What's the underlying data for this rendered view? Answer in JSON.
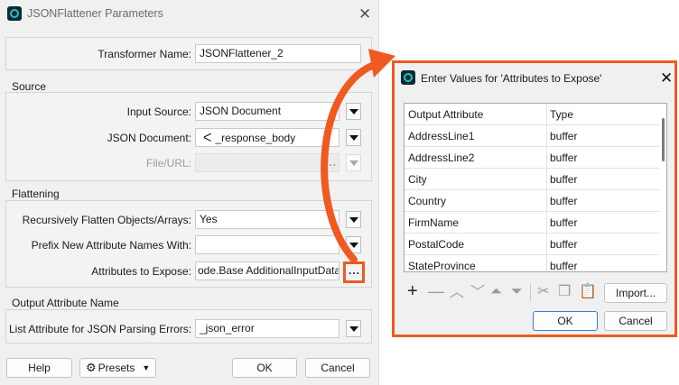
{
  "main": {
    "title": "JSONFlattener Parameters",
    "transformer_name_label": "Transformer Name:",
    "transformer_name_value": "JSONFlattener_2",
    "source": {
      "heading": "Source",
      "input_source_label": "Input Source:",
      "input_source_value": "JSON Document",
      "json_document_label": "JSON Document:",
      "json_document_value": "_response_body",
      "file_url_label": "File/URL:",
      "file_url_value": "",
      "browse": "..."
    },
    "flattening": {
      "heading": "Flattening",
      "recursive_label": "Recursively Flatten Objects/Arrays:",
      "recursive_value": "Yes",
      "prefix_label": "Prefix New Attribute Names With:",
      "prefix_value": "",
      "expose_label": "Attributes to Expose:",
      "expose_value": "ode.Base AdditionalInputData",
      "expose_button": "..."
    },
    "output": {
      "heading": "Output Attribute Name",
      "list_attr_label": "List Attribute for JSON Parsing Errors:",
      "list_attr_value": "_json_error"
    },
    "buttons": {
      "help": "Help",
      "presets": "Presets",
      "ok": "OK",
      "cancel": "Cancel"
    }
  },
  "dialog": {
    "title": "Enter Values for 'Attributes to Expose'",
    "columns": [
      "Output Attribute",
      "Type"
    ],
    "rows": [
      {
        "name": "AddressLine1",
        "type": "buffer"
      },
      {
        "name": "AddressLine2",
        "type": "buffer"
      },
      {
        "name": "City",
        "type": "buffer"
      },
      {
        "name": "Country",
        "type": "buffer"
      },
      {
        "name": "FirmName",
        "type": "buffer"
      },
      {
        "name": "PostalCode",
        "type": "buffer"
      },
      {
        "name": "StateProvince",
        "type": "buffer"
      }
    ],
    "import_button": "Import...",
    "ok": "OK",
    "cancel": "Cancel"
  },
  "colors": {
    "highlight": "#ee5a1f",
    "primary_border": "#3d79d6",
    "app_icon": "#20c3c3"
  },
  "icons": [
    "app-icon",
    "close-icon",
    "dropdown-arrow-icon",
    "attribute-value-icon",
    "gear-icon",
    "add-icon",
    "remove-icon",
    "move-up-icon",
    "move-down-icon",
    "move-top-icon",
    "move-bottom-icon",
    "cut-icon",
    "copy-icon",
    "paste-icon"
  ]
}
